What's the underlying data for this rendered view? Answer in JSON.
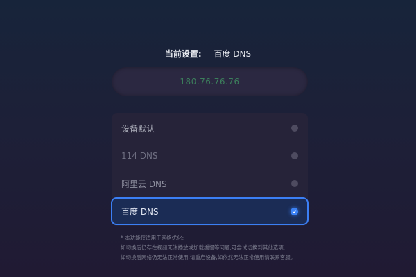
{
  "header": {
    "current_label": "当前设置:",
    "current_value": "百度 DNS"
  },
  "ip_display": "180.76.76.76",
  "dns_options": [
    {
      "label": "设备默认",
      "selected": false
    },
    {
      "label": "114 DNS",
      "selected": false
    },
    {
      "label": "阿里云 DNS",
      "selected": false
    },
    {
      "label": "百度 DNS",
      "selected": true
    }
  ],
  "notes": [
    "* 本功能仅适用于网络优化;",
    "如切换后仍存在视频无法播放或加载缓慢等问题,可尝试切换到其他选项;",
    "如切换后网络仍无法正常使用,请重启设备,如依然无法正常使用请联系客服。"
  ],
  "colors": {
    "accent": "#3b82f6",
    "ip_text": "#3c7f5c",
    "background_top": "#17243a",
    "background_bottom": "#201a33"
  }
}
